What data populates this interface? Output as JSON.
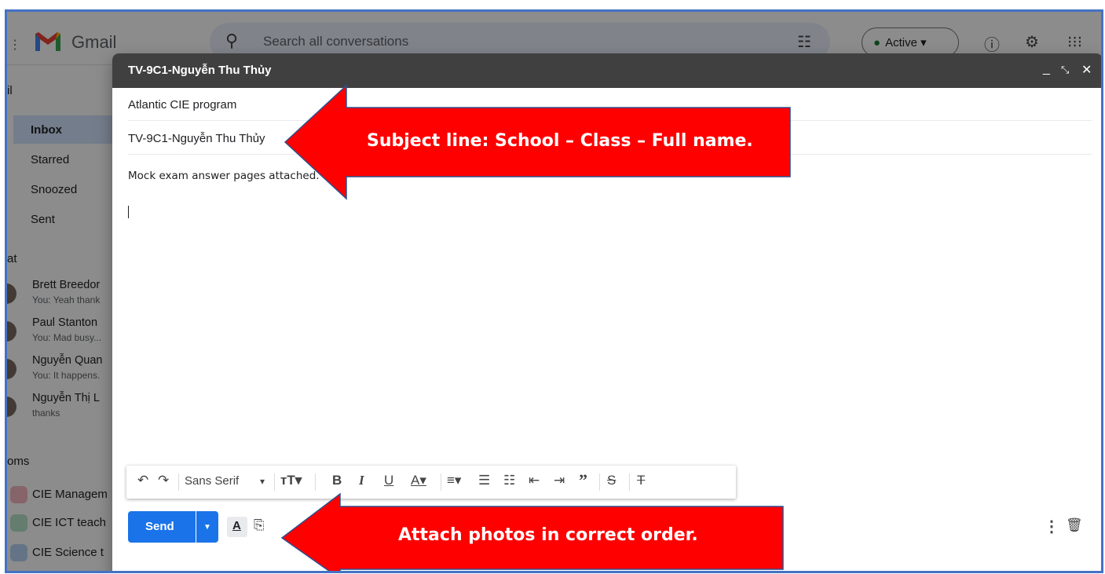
{
  "background": {
    "logo_text": "Gmail",
    "search_placeholder": "Search all conversations",
    "status_label": "Active",
    "sidebar": {
      "section_mail": "il",
      "nav": [
        {
          "label": "Inbox"
        },
        {
          "label": "Starred"
        },
        {
          "label": "Snoozed"
        },
        {
          "label": "Sent"
        }
      ],
      "section_chat": "at",
      "chats": [
        {
          "name": "Brett Breedor",
          "snippet": "You: Yeah thank"
        },
        {
          "name": "Paul Stanton",
          "snippet": "You: Mad busy..."
        },
        {
          "name": "Nguyễn Quan",
          "snippet": "You: It happens."
        },
        {
          "name": "Nguyễn Thị L",
          "snippet": "thanks"
        }
      ],
      "section_rooms": "oms",
      "rooms": [
        {
          "name": "CIE Managem",
          "color": "#f4b6c2"
        },
        {
          "name": "CIE ICT teach",
          "color": "#b6e3c8"
        },
        {
          "name": "CIE Science t",
          "color": "#b6d3f4"
        }
      ]
    }
  },
  "compose": {
    "title": "TV-9C1-Nguyễn Thu Thủy",
    "to": "Atlantic CIE program",
    "subject": "TV-9C1-Nguyễn Thu Thủy",
    "body": "Mock exam answer pages attached.",
    "toolbar": {
      "font": "Sans Serif"
    },
    "send_label": "Send"
  },
  "annotations": {
    "subject_arrow": "Subject line: School – Class – Full name.",
    "attach_arrow": "Attach photos in correct order."
  },
  "colors": {
    "send": "#1a73e8",
    "arrow": "#ff0000",
    "header": "#404040"
  }
}
